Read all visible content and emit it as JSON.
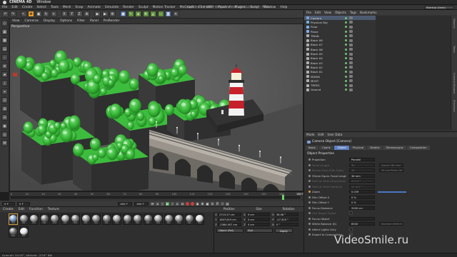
{
  "menubar": {
    "app": "CINEMA 4D",
    "window": "Window"
  },
  "window_title": "Untitled 6 * (NFR Version - Restricted License) - Main",
  "layout": {
    "label": "Startup (User)"
  },
  "app_menu": [
    "File",
    "Edit",
    "Create",
    "Select",
    "Tools",
    "Mesh",
    "Snap",
    "Animate",
    "Simulate",
    "Render",
    "Sculpt",
    "Motion Tracker",
    "MoGraph",
    "Character",
    "Pipeline",
    "Plugins",
    "Script",
    "Window",
    "Help"
  ],
  "viewport": {
    "menu": [
      "View",
      "Cameras",
      "Display",
      "Options",
      "Filter",
      "Panel",
      "ProRender"
    ],
    "label": "Perspective"
  },
  "timeline": {
    "ticks": [
      "0",
      "10",
      "20",
      "30",
      "40",
      "50",
      "60",
      "70",
      "80",
      "90",
      "100",
      "110",
      "120",
      "130",
      "140",
      "150",
      "160",
      "170"
    ],
    "end_label": "180 F",
    "current_progress": 0.94
  },
  "transport": {
    "start_frame": "0 F",
    "current_field": "0 F",
    "end_field": "180 F",
    "max_field": "180 F"
  },
  "material_manager": {
    "menu": [
      "Create",
      "Edit",
      "Function",
      "Texture"
    ],
    "materials": [
      {
        "name": "Mat",
        "color": "#7a9ad0"
      },
      {
        "name": "Mat",
        "color": "#8a8a8a"
      },
      {
        "name": "Mat",
        "color": "#9a9a9a"
      },
      {
        "name": "Mat",
        "color": "#707070"
      },
      {
        "name": "Mat",
        "color": "#8c8c8c"
      },
      {
        "name": "Mat",
        "color": "#a5a5a5"
      },
      {
        "name": "Mat",
        "color": "#7d7d7d"
      },
      {
        "name": "Mat",
        "color": "#969696"
      },
      {
        "name": "Mat",
        "color": "#8a8a8a"
      },
      {
        "name": "Mat",
        "color": "#7a7a7a"
      },
      {
        "name": "Mat",
        "color": "#9e9e9e"
      },
      {
        "name": "Mat",
        "color": "#868686"
      },
      {
        "name": "Mat",
        "color": "#8e8e8e"
      },
      {
        "name": "Mat",
        "color": "#7c7c7c"
      },
      {
        "name": "Mat",
        "color": "#a0a0a0"
      },
      {
        "name": "Mat",
        "color": "#8a8a8a"
      },
      {
        "name": "Mat",
        "color": "#929292"
      },
      {
        "name": "Mat",
        "color": "#7f7f7f"
      },
      {
        "name": "Mat",
        "color": "#d8d8d8"
      },
      {
        "name": "Mat",
        "color": "#6a6a6a"
      },
      {
        "name": "Mat",
        "color": "#e8e8e8"
      }
    ]
  },
  "coordinates": {
    "headers": [
      "Position",
      "Size",
      "Rotation"
    ],
    "rows": [
      {
        "axis": "X",
        "pos": "2715.27 cm",
        "size": "0 cm",
        "rot_axis": "H",
        "rot": "38.58 °"
      },
      {
        "axis": "Y",
        "pos": "1607.619 cm",
        "size": "0 cm",
        "rot_axis": "P",
        "rot": "-27.325 °"
      },
      {
        "axis": "Z",
        "pos": "-2384.007 cm",
        "size": "0 cm",
        "rot_axis": "B",
        "rot": "0 °"
      }
    ],
    "mode": "Object (Rel)",
    "size_mode": "Size",
    "apply": "Apply"
  },
  "object_manager": {
    "menu": [
      "File",
      "Edit",
      "View",
      "Objects",
      "Tags",
      "Bookmarks"
    ],
    "objects": [
      {
        "name": "Camera",
        "color": "#7fa0d0",
        "selected": true
      },
      {
        "name": "Physical Sky",
        "color": "#6fb0e0",
        "selected": false
      },
      {
        "name": "Floor",
        "color": "#80b0ff",
        "selected": false
      },
      {
        "name": "Plane",
        "color": "#80b0ff",
        "selected": false
      },
      {
        "name": "TRAIN",
        "color": "#b0b0b0",
        "selected": false
      },
      {
        "name": "Block 08",
        "color": "#b0b0b0",
        "selected": false
      },
      {
        "name": "Block 07",
        "color": "#b0b0b0",
        "selected": false
      },
      {
        "name": "Block 06",
        "color": "#b0b0b0",
        "selected": false
      },
      {
        "name": "Block 05",
        "color": "#b0b0b0",
        "selected": false
      },
      {
        "name": "Block 04",
        "color": "#b0b0b0",
        "selected": false
      },
      {
        "name": "Block 03",
        "color": "#b0b0b0",
        "selected": false
      },
      {
        "name": "Block 02",
        "color": "#b0b0b0",
        "selected": false
      },
      {
        "name": "Block 01",
        "color": "#b0b0b0",
        "selected": false
      },
      {
        "name": "MAYAK",
        "color": "#b0b0b0",
        "selected": false
      },
      {
        "name": "MOST",
        "color": "#b0b0b0",
        "selected": false
      },
      {
        "name": "TREES",
        "color": "#b0b0b0",
        "selected": false
      },
      {
        "name": "Ground",
        "color": "#b0b0b0",
        "selected": false
      }
    ],
    "side_tabs": [
      "Objects",
      "Takes",
      "Content Browser",
      "Structure"
    ]
  },
  "attributes": {
    "menu": [
      "Mode",
      "Edit",
      "User Data"
    ],
    "object_title": "Camera Object [Camera]",
    "tabs": [
      {
        "label": "Basic",
        "active": false
      },
      {
        "label": "Coord.",
        "active": false
      },
      {
        "label": "Object",
        "active": true
      },
      {
        "label": "Physical",
        "active": false
      },
      {
        "label": "Details",
        "active": false
      },
      {
        "label": "Stereoscopic",
        "active": false
      },
      {
        "label": "Composition",
        "active": false
      }
    ],
    "section": "Object Properties",
    "rows": [
      {
        "label": "Projection",
        "value": "Parallel",
        "dim": false,
        "key": false,
        "extra": ""
      },
      {
        "label": "Focal Length",
        "value": "36",
        "dim": true,
        "key": false,
        "extra": "Classic (36 mm)"
      },
      {
        "label": "Sensor Size (Film Gate)",
        "value": "36",
        "dim": true,
        "key": false,
        "extra": "35 mm Photo (36.0 mm)"
      },
      {
        "label": "35mm Equiv. Focal Length:",
        "value": "36 mm",
        "dim": false,
        "key": false,
        "extra": ""
      },
      {
        "label": "Field of View (Horizontal)",
        "value": "53.13 °",
        "dim": true,
        "key": false,
        "extra": ""
      },
      {
        "label": "Field of View (Vertical)",
        "value": "31.417 °",
        "dim": true,
        "key": false,
        "extra": ""
      },
      {
        "label": "Zoom",
        "value": "0.039",
        "dim": false,
        "key": true,
        "extra": ""
      },
      {
        "label": "Film Offset X",
        "value": "0 %",
        "dim": false,
        "key": false,
        "extra": ""
      },
      {
        "label": "Film Offset Y",
        "value": "0 %",
        "dim": false,
        "key": false,
        "extra": ""
      },
      {
        "label": "Focus Distance",
        "value": "2000 cm",
        "dim": false,
        "key": false,
        "extra": ""
      },
      {
        "label": "Use Target Object",
        "value": "",
        "dim": true,
        "key": false,
        "extra": ""
      },
      {
        "label": "Focus Object",
        "value": "",
        "dim": false,
        "key": false,
        "extra": ""
      },
      {
        "label": "White Balance (K)",
        "value": "6500",
        "dim": false,
        "key": false,
        "extra": "Daylight (6500 K)"
      },
      {
        "label": "Affect Lights Only",
        "value": "",
        "dim": false,
        "key": false,
        "extra": ""
      },
      {
        "label": "Export to Compositing",
        "value": "✓",
        "dim": false,
        "key": false,
        "extra": ""
      }
    ]
  },
  "status_bar": {
    "text": "Azimuth: 54.00°, Altitude: -23.6° NW"
  },
  "watermark": "VideoSmile.ru",
  "colors": {
    "grass": "#3dbd3d",
    "tree_dark": "#2e8a2e",
    "rock": "#3a3a3a",
    "lighthouse_red": "#c8202a",
    "accent": "#5d80c0"
  }
}
